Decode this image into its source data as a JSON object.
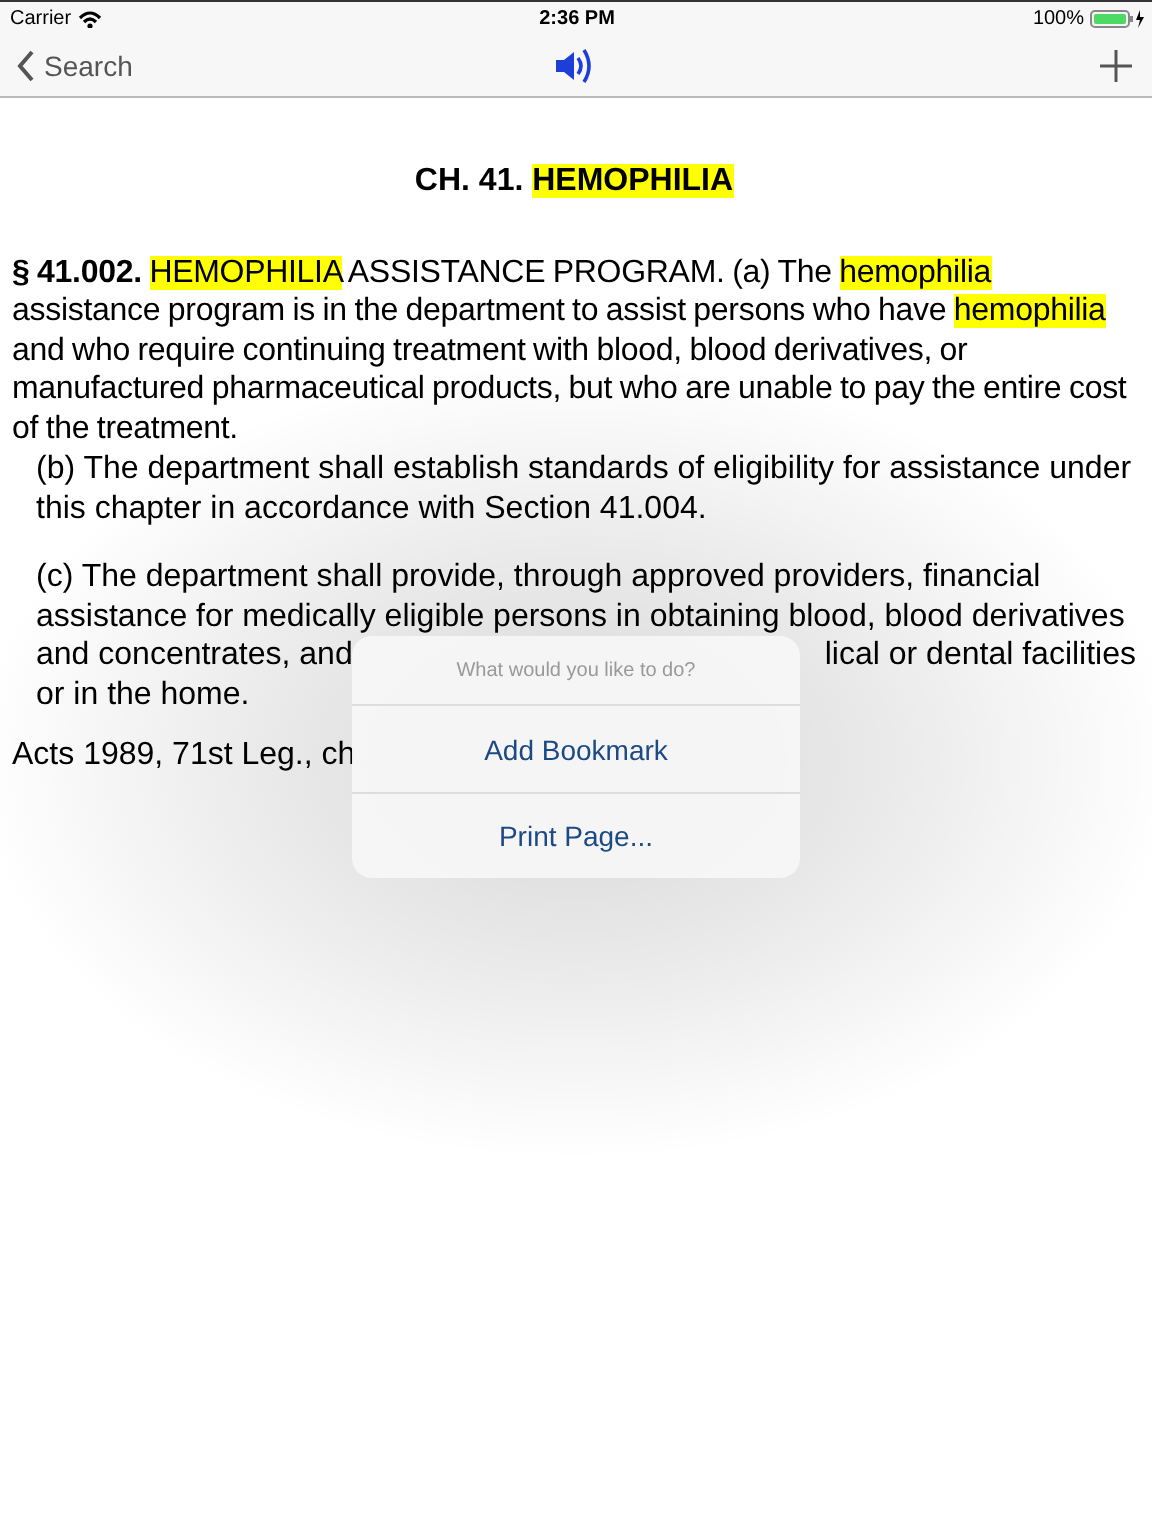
{
  "status_bar": {
    "carrier": "Carrier",
    "time": "2:36 PM",
    "battery": "100%"
  },
  "nav_bar": {
    "back_label": "Search"
  },
  "document": {
    "title": [
      {
        "text": "CH. 41. ",
        "highlighted": false
      },
      {
        "text": "HEMOPHILIA",
        "highlighted": true
      }
    ],
    "paragraphs": [
      {
        "kind": "section",
        "segments": [
          {
            "text": "§ 41.002. ",
            "bold": true,
            "highlighted": false
          },
          {
            "text": "HEMOPHILIA",
            "bold": false,
            "highlighted": true
          },
          {
            "text": " ASSISTANCE PROGRAM. (a) The ",
            "bold": false,
            "highlighted": false
          },
          {
            "text": "hemophilia",
            "bold": false,
            "highlighted": true
          },
          {
            "text": " assistance program is in the department to assist persons who have ",
            "bold": false,
            "highlighted": false
          },
          {
            "text": "hemophilia",
            "bold": false,
            "highlighted": true
          },
          {
            "text": " and who require continuing treatment with blood, blood derivatives, or manufactured pharmaceutical products, but who are unable to pay the entire cost of the treatment.",
            "bold": false,
            "highlighted": false
          }
        ]
      },
      {
        "kind": "subsection",
        "lines": [
          "(b) The department shall establish standards of eligibility for assistance under this chapter in accordance with Section 41.004."
        ]
      },
      {
        "kind": "subsection",
        "lines": [
          "(c) The department shall provide, through approved providers, financial assistance for medically eligible persons in obtaining blood, blood derivatives",
          "and concentrates, and",
          "lical or dental facilities",
          "or in the home."
        ]
      },
      {
        "kind": "note",
        "lines": [
          "Acts 1989, 71st Leg., ch"
        ]
      }
    ]
  },
  "popover": {
    "title": "What would you like to do?",
    "actions": [
      "Add Bookmark",
      "Print Page..."
    ]
  }
}
